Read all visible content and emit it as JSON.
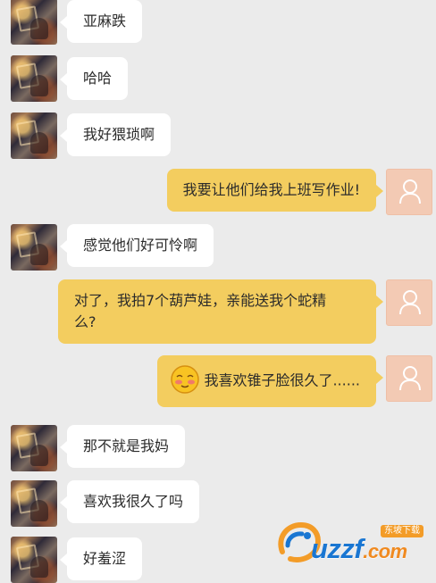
{
  "conversation": [
    {
      "side": "left",
      "avatar": "photo-avatar",
      "text": "亚麻跌"
    },
    {
      "side": "left",
      "avatar": "photo-avatar",
      "text": "哈哈"
    },
    {
      "side": "left",
      "avatar": "photo-avatar",
      "text": "我好猥琐啊"
    },
    {
      "side": "right",
      "avatar": "person-icon",
      "text": "我要让他们给我上班写作业!"
    },
    {
      "side": "left",
      "avatar": "photo-avatar",
      "text": "感觉他们好可怜啊"
    },
    {
      "side": "right",
      "avatar": "person-icon",
      "text_line1": "对了，我拍7个葫芦娃，亲能送我个蛇精",
      "text_line2": "么?"
    },
    {
      "side": "right",
      "avatar": "person-icon",
      "emoji": "blush-face-icon",
      "text": "我喜欢锥子脸很久了......"
    },
    {
      "side": "left",
      "avatar": "photo-avatar",
      "text": "那不就是我妈"
    },
    {
      "side": "left",
      "avatar": "photo-avatar",
      "text": "喜欢我很久了吗"
    },
    {
      "side": "left",
      "avatar": "photo-avatar",
      "text": "好羞涩"
    }
  ],
  "watermark": {
    "brand": "uzzf",
    "suffix": ".com",
    "badge": "东坡下载"
  },
  "colors": {
    "background": "#ebebeb",
    "incoming_bubble": "#ffffff",
    "outgoing_bubble": "#f3cd5f",
    "placeholder_avatar": "#f3cab4",
    "brand_blue": "#1976d2",
    "brand_orange": "#f39c28"
  }
}
